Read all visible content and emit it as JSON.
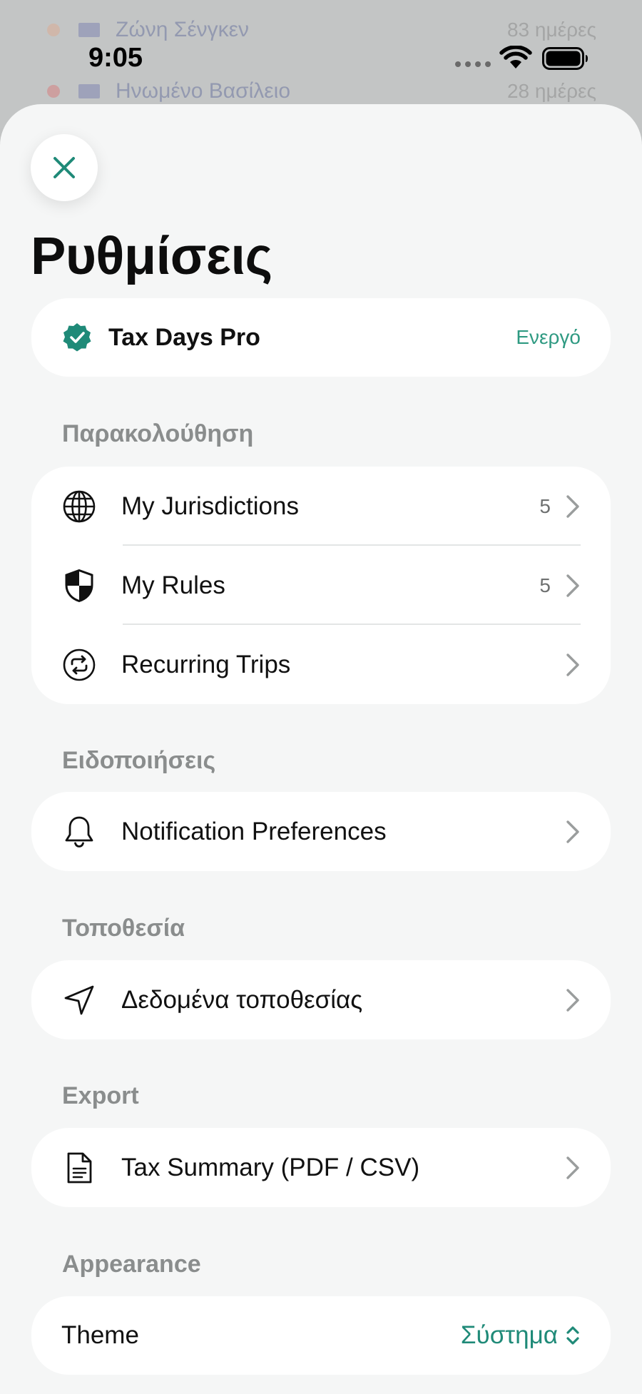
{
  "background_list": [
    {
      "name": "Ζώνη Σένγκεν",
      "value": "83 ημέρες",
      "dot_color": "#e8a07a"
    },
    {
      "name": "Ηνωμένο Βασίλειο",
      "value": "28 ημέρες",
      "dot_color": "#e05a5a"
    }
  ],
  "status_bar": {
    "time": "9:05"
  },
  "sheet": {
    "title": "Ρυθμίσεις",
    "subscription": {
      "name": "Tax Days Pro",
      "status": "Ενεργό"
    },
    "sections": {
      "tracking": {
        "label": "Παρακολούθηση",
        "items": [
          {
            "label": "My Jurisdictions",
            "count": "5",
            "icon": "globe-icon"
          },
          {
            "label": "My Rules",
            "count": "5",
            "icon": "shield-icon"
          },
          {
            "label": "Recurring Trips",
            "count": "",
            "icon": "repeat-icon"
          }
        ]
      },
      "notifications": {
        "label": "Ειδοποιήσεις",
        "items": [
          {
            "label": "Notification Preferences",
            "icon": "bell-icon"
          }
        ]
      },
      "location": {
        "label": "Τοποθεσία",
        "items": [
          {
            "label": "Δεδομένα τοποθεσίας",
            "icon": "location-arrow-icon"
          }
        ]
      },
      "export": {
        "label": "Export",
        "items": [
          {
            "label": "Tax Summary (PDF / CSV)",
            "icon": "document-icon"
          }
        ]
      },
      "appearance": {
        "label": "Appearance",
        "theme_label": "Theme",
        "theme_value": "Σύστημα"
      }
    }
  },
  "colors": {
    "accent": "#1f8a78",
    "active_status": "#2f9a82",
    "sheet_background": "#f5f6f6",
    "card_background": "#ffffff",
    "section_label": "#8a8d8d"
  }
}
